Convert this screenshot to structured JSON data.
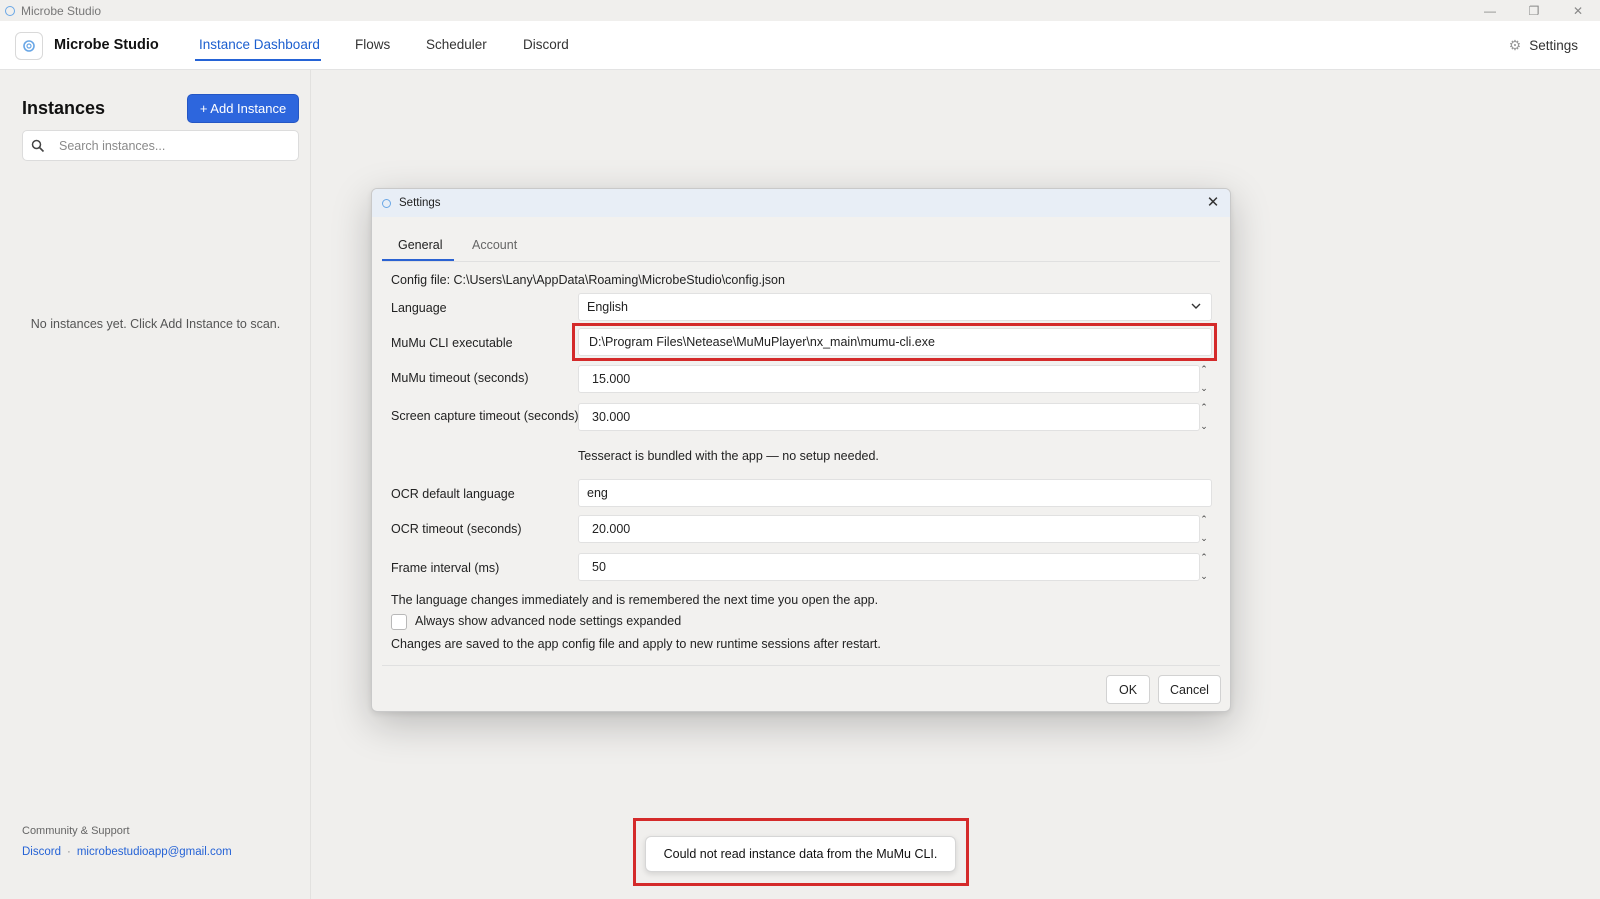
{
  "window": {
    "title": "Microbe Studio"
  },
  "nav": {
    "brand": "Microbe Studio",
    "tabs": [
      {
        "label": "Instance Dashboard",
        "active": true
      },
      {
        "label": "Flows",
        "active": false
      },
      {
        "label": "Scheduler",
        "active": false
      },
      {
        "label": "Discord",
        "active": false
      }
    ],
    "settings_label": "Settings"
  },
  "sidebar": {
    "title": "Instances",
    "add_button": "+ Add Instance",
    "search_placeholder": "Search instances...",
    "empty_message": "No instances yet. Click Add Instance to scan.",
    "community_label": "Community & Support",
    "links": {
      "discord": "Discord",
      "separator": "·",
      "email": "microbestudioapp@gmail.com"
    }
  },
  "dialog": {
    "title": "Settings",
    "tabs": [
      {
        "label": "General",
        "active": true
      },
      {
        "label": "Account",
        "active": false
      }
    ],
    "config_file": "Config file: C:\\Users\\Lany\\AppData\\Roaming\\MicrobeStudio\\config.json",
    "fields": {
      "language": {
        "label": "Language",
        "value": "English"
      },
      "mumu_cli": {
        "label": "MuMu CLI executable",
        "value": "D:\\Program Files\\Netease\\MuMuPlayer\\nx_main\\mumu-cli.exe"
      },
      "mumu_timeout": {
        "label": "MuMu timeout (seconds)",
        "value": "15.000"
      },
      "capture_timeout": {
        "label": "Screen capture timeout (seconds)",
        "value": "30.000"
      },
      "tesseract_note": "Tesseract is bundled with the app — no setup needed.",
      "ocr_language": {
        "label": "OCR default language",
        "value": "eng"
      },
      "ocr_timeout": {
        "label": "OCR timeout (seconds)",
        "value": "20.000"
      },
      "frame_interval": {
        "label": "Frame interval (ms)",
        "value": "50"
      }
    },
    "language_note": "The language changes immediately and is remembered the next time you open the app.",
    "advanced_checkbox": {
      "label": "Always show advanced node settings expanded",
      "checked": false
    },
    "save_note": "Changes are saved to the app config file and apply to new runtime sessions after restart.",
    "ok_label": "OK",
    "cancel_label": "Cancel"
  },
  "toast": {
    "message": "Could not read instance data from the MuMu CLI."
  },
  "colors": {
    "accent": "#2d66dd",
    "highlight": "#d42a2a"
  }
}
